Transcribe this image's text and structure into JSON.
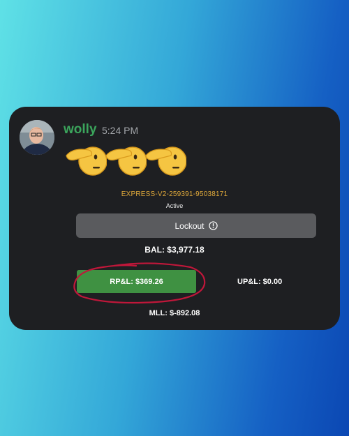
{
  "message": {
    "username": "wolly",
    "timestamp": "5:24 PM",
    "emojis": [
      "saluting-face-emoji",
      "saluting-face-emoji",
      "saluting-face-emoji"
    ]
  },
  "account": {
    "id": "EXPRESS-V2-259391-95038171",
    "status": "Active",
    "lockout_label": "Lockout",
    "balance": "BAL: $3,977.18",
    "realized_pnl": "RP&L: $369.26",
    "unrealized_pnl": "UP&L: $0.00",
    "mll": "MLL: $-892.08"
  },
  "colors": {
    "username": "#3ba55c",
    "account_id": "#e0a93a",
    "rpl_button": "#3f9142",
    "lockout_button": "#5a5b5e",
    "annotation": "#c0173a",
    "card_background": "#1e1f22"
  },
  "icons": {
    "lockout": "info-circle-icon",
    "annotation": "hand-drawn-circle"
  }
}
